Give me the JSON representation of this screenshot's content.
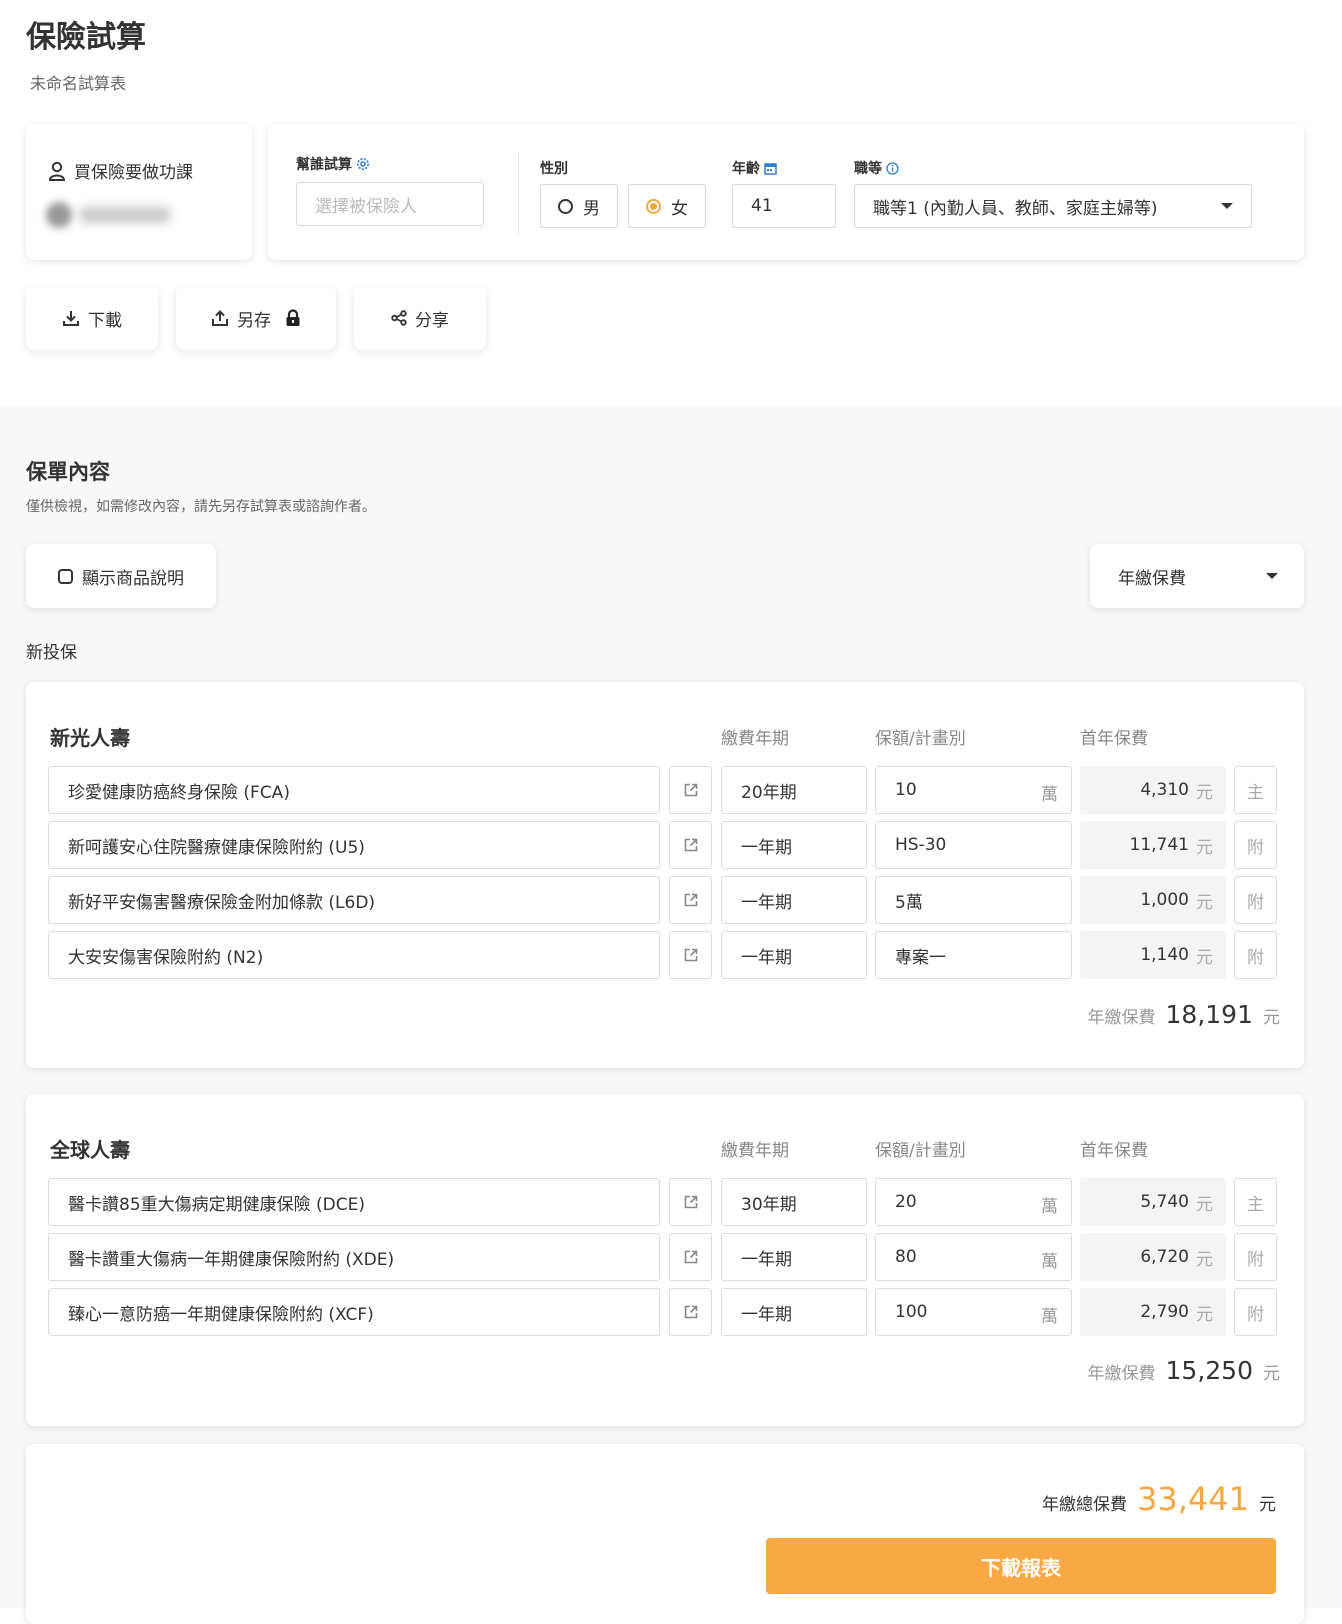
{
  "header": {
    "title": "保險試算",
    "subtitle": "未命名試算表"
  },
  "author": {
    "name": "買保險要做功課"
  },
  "form": {
    "insured_label": "幫誰試算",
    "insured_placeholder": "選擇被保險人",
    "gender_label": "性別",
    "gender_options": [
      "男",
      "女"
    ],
    "gender_selected": "女",
    "age_label": "年齡",
    "age_value": "41",
    "occupation_label": "職等",
    "occupation_value": "職等1 (內勤人員、教師、家庭主婦等)"
  },
  "actions": {
    "download_label": "下載",
    "save_as_label": "另存",
    "share_label": "分享"
  },
  "policy": {
    "section_title": "保單內容",
    "note": "僅供檢視，如需修改內容，請先另存試算表或諮詢作者。",
    "show_desc_label": "顯示商品說明",
    "period_select": "年繳保費",
    "new_label": "新投保"
  },
  "columns": {
    "term": "繳費年期",
    "amount": "保額/計畫別",
    "premium": "首年保費"
  },
  "companies": [
    {
      "name": "新光人壽",
      "rows": [
        {
          "product": "珍愛健康防癌終身保險 (FCA)",
          "term": "20年期",
          "amount": "10",
          "amount_unit": "萬",
          "premium": "4,310",
          "premium_unit": "元",
          "tag": "主"
        },
        {
          "product": "新呵護安心住院醫療健康保險附約 (U5)",
          "term": "一年期",
          "amount": "HS-30",
          "amount_unit": "",
          "premium": "11,741",
          "premium_unit": "元",
          "tag": "附"
        },
        {
          "product": "新好平安傷害醫療保險金附加條款 (L6D)",
          "term": "一年期",
          "amount": "5萬",
          "amount_unit": "",
          "premium": "1,000",
          "premium_unit": "元",
          "tag": "附"
        },
        {
          "product": "大安安傷害保險附約 (N2)",
          "term": "一年期",
          "amount": "專案一",
          "amount_unit": "",
          "premium": "1,140",
          "premium_unit": "元",
          "tag": "附"
        }
      ],
      "subtotal_label": "年繳保費",
      "subtotal": "18,191",
      "subtotal_unit": "元"
    },
    {
      "name": "全球人壽",
      "rows": [
        {
          "product": "醫卡讚85重大傷病定期健康保險 (DCE)",
          "term": "30年期",
          "amount": "20",
          "amount_unit": "萬",
          "premium": "5,740",
          "premium_unit": "元",
          "tag": "主"
        },
        {
          "product": "醫卡讚重大傷病一年期健康保險附約 (XDE)",
          "term": "一年期",
          "amount": "80",
          "amount_unit": "萬",
          "premium": "6,720",
          "premium_unit": "元",
          "tag": "附"
        },
        {
          "product": "臻心一意防癌一年期健康保險附約 (XCF)",
          "term": "一年期",
          "amount": "100",
          "amount_unit": "萬",
          "premium": "2,790",
          "premium_unit": "元",
          "tag": "附"
        }
      ],
      "subtotal_label": "年繳保費",
      "subtotal": "15,250",
      "subtotal_unit": "元"
    }
  ],
  "total": {
    "label": "年繳總保費",
    "value": "33,441",
    "unit": "元",
    "report_button": "下載報表"
  },
  "colors": {
    "accent": "#f5a742",
    "button": "#f8a943",
    "icon_blue": "#2f7fd1"
  },
  "icons": [
    "user-icon",
    "gear-icon",
    "calendar-icon",
    "info-icon",
    "download-icon",
    "save-icon",
    "lock-icon",
    "share-icon",
    "external-link-icon",
    "caret-down-icon"
  ]
}
